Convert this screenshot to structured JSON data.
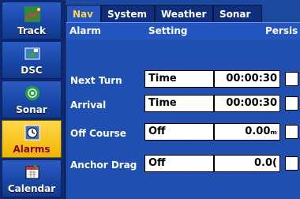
{
  "tabs": [
    {
      "label": "Nav",
      "active": true
    },
    {
      "label": "System",
      "active": false
    },
    {
      "label": "Weather",
      "active": false
    },
    {
      "label": "Sonar",
      "active": false
    }
  ],
  "header": {
    "col_alarm": "Alarm",
    "col_setting": "Setting",
    "col_persist": "Persis"
  },
  "sidebar": {
    "items": [
      {
        "label": "Track",
        "icon": "track-icon",
        "active": false
      },
      {
        "label": "DSC",
        "icon": "dsc-icon",
        "active": false
      },
      {
        "label": "Sonar",
        "icon": "sonar-icon",
        "active": false
      },
      {
        "label": "Alarms",
        "icon": "alarm-clock-icon",
        "active": true
      },
      {
        "label": "Calendar",
        "icon": "calendar-icon",
        "active": false
      }
    ]
  },
  "alarms": [
    {
      "label": "Next Turn",
      "mode": "Time",
      "value": "00:00:30",
      "checked": false
    },
    {
      "label": "Arrival",
      "mode": "Time",
      "value": "00:00:30",
      "checked": false
    },
    {
      "label": "Off Course",
      "mode": "Off",
      "value": "0.00ₘ",
      "checked": false
    },
    {
      "label": "Anchor Drag",
      "mode": "Off",
      "value": "0.0(",
      "checked": false
    }
  ],
  "colors": {
    "background": "#1f4fb0",
    "sidebar": "#0d2a70",
    "active_tab_text": "#ffd54a",
    "active_sidebar": "#f0b400",
    "active_sidebar_text": "#8a0000"
  }
}
